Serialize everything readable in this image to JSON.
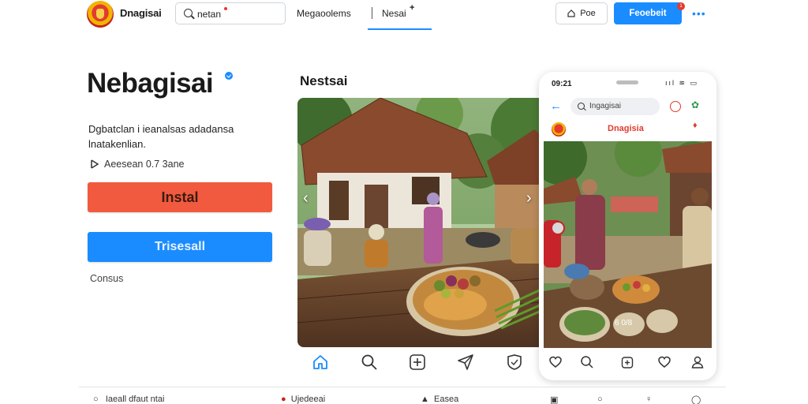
{
  "header": {
    "brand_name": "Dnagisai",
    "search_value": "netan",
    "nav_link_1": "Megaoolems",
    "nav_link_2": "Nesai",
    "nav_link_2_badge": "+",
    "post_label": "Poe",
    "primary_label": "Feoebeit",
    "primary_badge": "1"
  },
  "hero": {
    "title": "Nebagisai",
    "description": "Dgbatclan i ieanalsas adadansa lnatakenlian.",
    "meta": "Aeesean 0.7 3ane",
    "install_label": "Instal",
    "secondary_label": "Trisesall",
    "contact_label": "Consus"
  },
  "gallery": {
    "title": "Nestsai"
  },
  "phone": {
    "time": "09:21",
    "status": "ııl ≋ ▭",
    "search_value": "Ingagisai",
    "brand": "Dnagisia",
    "caption": "6 0/8"
  },
  "bottom": {
    "item_1": "Iaeall dfaut ntai",
    "item_2": "Ujedeeai",
    "item_3": "Easea"
  },
  "colors": {
    "accent": "#1a8cff",
    "install": "#f15a3e",
    "brand_red": "#e23b2e"
  },
  "icons": [
    "search-icon",
    "house-icon",
    "more-icon",
    "verified-icon",
    "play-icon",
    "chevron-left-icon",
    "chevron-right-icon",
    "home-icon",
    "add-icon",
    "send-icon",
    "shield-icon",
    "heart-icon",
    "profile-icon",
    "back-arrow-icon",
    "help-icon",
    "share-icon"
  ]
}
